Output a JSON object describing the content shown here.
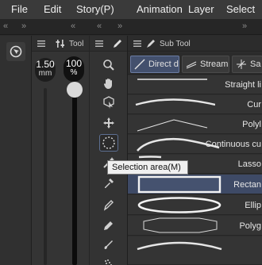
{
  "menu": [
    "File",
    "Edit",
    "Story(P)",
    "Animation",
    "Layer",
    "Select"
  ],
  "panels": {
    "tool_header": "Tool",
    "sub_tool_header": "Sub Tool"
  },
  "brush": {
    "size_value": "1.50",
    "size_unit": "mm",
    "opacity_value": "100",
    "opacity_unit": "%"
  },
  "sub_tool_tabs": [
    "Direct d",
    "Stream",
    "Sa"
  ],
  "sub_tools": [
    {
      "name": "Straight li",
      "selected": false
    },
    {
      "name": "Cur",
      "selected": false
    },
    {
      "name": "Polyl",
      "selected": false
    },
    {
      "name": "Continuous cu",
      "selected": false
    },
    {
      "name": "Lasso",
      "selected": false
    },
    {
      "name": "Rectan",
      "selected": true
    },
    {
      "name": "Ellip",
      "selected": false
    },
    {
      "name": "Polyg",
      "selected": false
    },
    {
      "name": "",
      "selected": false
    }
  ],
  "tooltip": "Selection area(M)",
  "colors": {
    "accent": "#43506d",
    "selected_row": "#3e4a66",
    "background": "#2b2b2b"
  },
  "tool_icons": [
    "magnifier-icon",
    "hand-icon",
    "object-select-icon",
    "move-icon",
    "selection-area-icon",
    "wand-icon",
    "eyedropper-icon",
    "pen-icon",
    "pencil-icon",
    "brush-icon",
    "airbrush-icon"
  ]
}
